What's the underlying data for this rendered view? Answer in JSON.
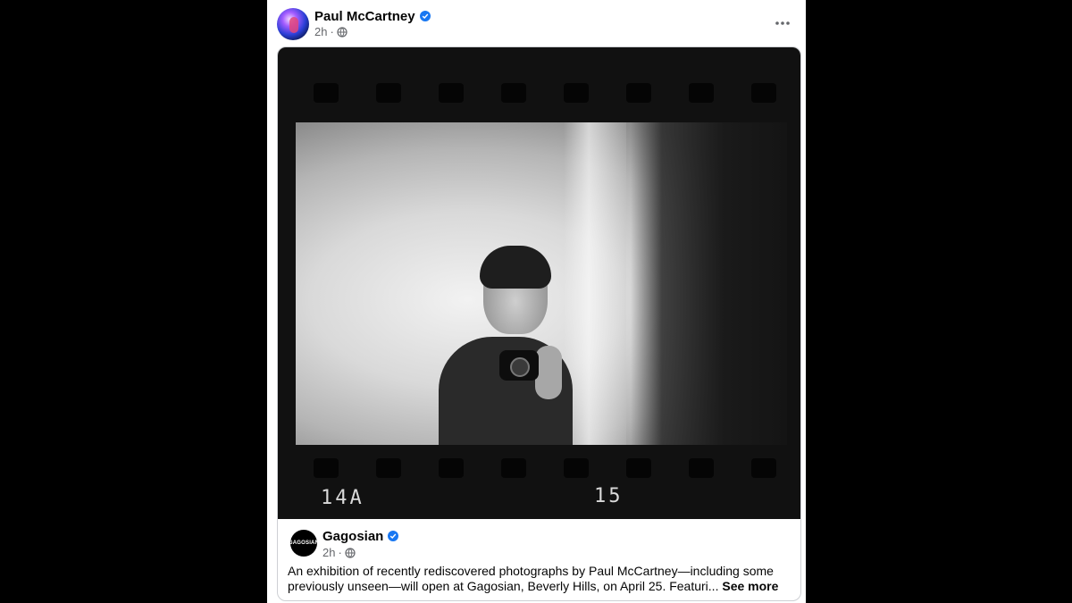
{
  "post": {
    "author": "Paul McCartney",
    "timestamp": "2h",
    "separator": "·",
    "privacy_icon": "globe-icon",
    "verified_icon": "verified-badge-icon",
    "more_icon": "more-options-icon"
  },
  "photo": {
    "frame_label_left": "14A",
    "frame_label_right": "15"
  },
  "shared_post": {
    "page_name": "Gagosian",
    "page_avatar_text": "GAGOSIAN",
    "timestamp": "2h",
    "separator": "·",
    "caption": "An exhibition of recently rediscovered photographs by Paul McCartney—including some previously unseen—will open at Gagosian, Beverly Hills, on April 25. Featuri...",
    "see_more_label": "See more"
  },
  "colors": {
    "accent": "#1877f2",
    "text_primary": "#050505",
    "text_secondary": "#65676b",
    "backdrop": "#000000"
  }
}
